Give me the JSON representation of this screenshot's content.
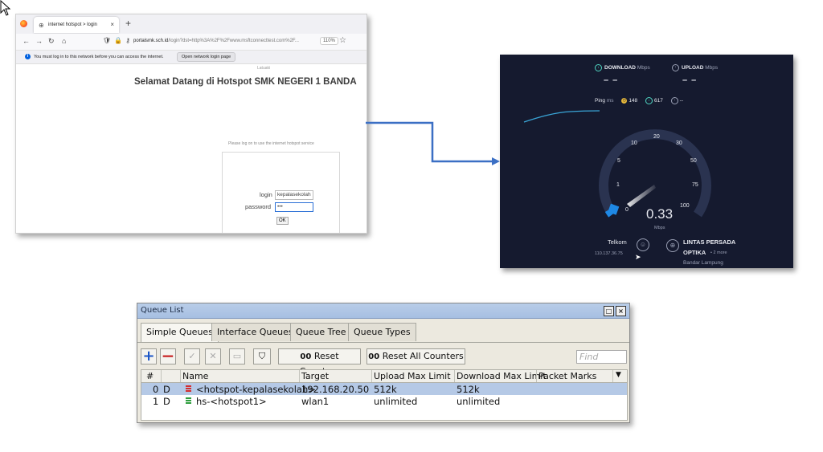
{
  "browser": {
    "tab_title": "internet hotspot > login",
    "url_domain": "portalsmk.sch.id",
    "url_rest": "/login?dst=http%3A%2F%2Fwww.msftconnecttest.com%2F...",
    "zoom": "110%",
    "notice": "You must log in to this network before you can access the internet.",
    "open_login_button": "Open network login page",
    "page_small_label": "Latuaki",
    "welcome": "Selamat Datang di Hotspot SMK NEGERI 1 BANDA",
    "please_login": "Please log on to use the internet hotspot service",
    "login_label": "login",
    "login_value": "kepalasekolah",
    "password_label": "password",
    "password_value": "•••",
    "ok_label": "OK"
  },
  "speedtest": {
    "download_label": "DOWNLOAD",
    "upload_label": "UPLOAD",
    "unit": "Mbps",
    "download_value": "– –",
    "upload_value": "– –",
    "ping_label": "Ping",
    "ping_unit": "ms",
    "ping_idle": "148",
    "ping_download": "617",
    "ping_upload": "--",
    "speed_value": "0.33",
    "gauge_ticks": [
      "0",
      "1",
      "5",
      "10",
      "20",
      "30",
      "50",
      "75",
      "100"
    ],
    "isp_name": "Telkom",
    "isp_ip": "110.137.36.75",
    "server_name_line1": "LINTAS PERSADA",
    "server_name_line2": "OPTIKA",
    "server_more": "• 2 more",
    "server_location": "Bandar Lampung"
  },
  "queue": {
    "title": "Queue List",
    "tabs": [
      "Simple Queues",
      "Interface Queues",
      "Queue Tree",
      "Queue Types"
    ],
    "reset_counters": "Reset Counters",
    "reset_all_counters": "Reset All Counters",
    "find_placeholder": "Find",
    "columns": [
      "#",
      "Name",
      "Target",
      "Upload Max Limit",
      "Download Max Limit",
      "Packet Marks"
    ],
    "rows": [
      {
        "num": "0",
        "flag": "D",
        "name": "<hotspot-kepalasekolah>",
        "target": "192.168.20.50",
        "upload": "512k",
        "download": "512k",
        "marks": ""
      },
      {
        "num": "1",
        "flag": "D",
        "name": "hs-<hotspot1>",
        "target": "wlan1",
        "upload": "unlimited",
        "download": "unlimited",
        "marks": ""
      }
    ],
    "colors": {
      "selected_row": "#b5c9e6",
      "titlebar": "#a6bfe2"
    }
  },
  "colors": {
    "connector": "#3b6fc4",
    "speed_bg": "#151a2f",
    "accent": "#1e88e5"
  }
}
